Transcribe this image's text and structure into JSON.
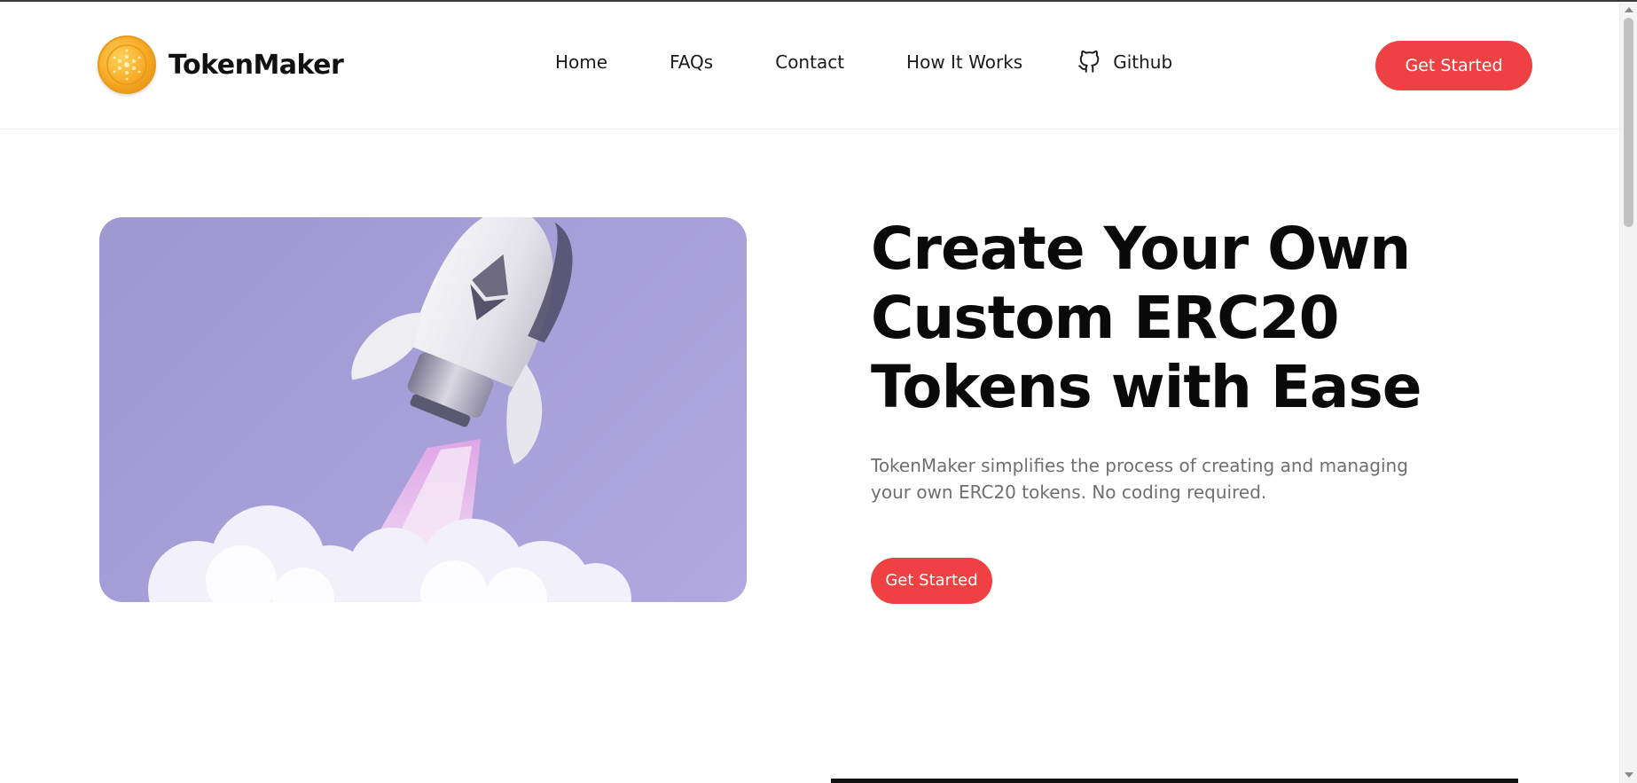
{
  "header": {
    "brand_name": "TokenMaker",
    "logo_icon": "coin-logo-icon",
    "nav": {
      "home": "Home",
      "faqs": "FAQs",
      "contact": "Contact",
      "how_it_works": "How It Works",
      "github": "Github"
    },
    "cta_label": "Get Started"
  },
  "hero": {
    "title": "Create Your Own Custom ERC20 Tokens with Ease",
    "subtitle": "TokenMaker simplifies the process of creating and managing your own ERC20 tokens. No coding required.",
    "cta_label": "Get Started",
    "image_icon": "rocket-launch-illustration"
  },
  "colors": {
    "accent": "#ef4044",
    "hero_image_bg": "#a79fd8",
    "logo_gold": "#f6a823"
  }
}
